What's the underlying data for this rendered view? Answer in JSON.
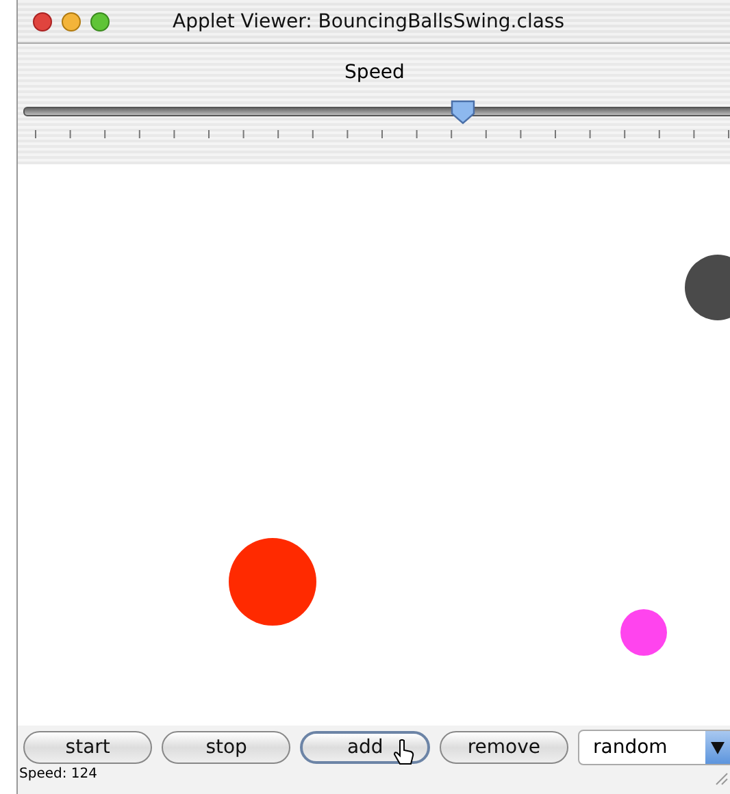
{
  "window": {
    "title": "Applet Viewer: BouncingBallsSwing.class"
  },
  "slider": {
    "label": "Speed",
    "level": 0.62
  },
  "balls": [
    {
      "color": "#4a4a4a"
    },
    {
      "color": "#ff2a00"
    },
    {
      "color": "#ff44ee"
    }
  ],
  "buttons": [
    {
      "label": "start",
      "focused": false
    },
    {
      "label": "stop",
      "focused": false
    },
    {
      "label": "add",
      "focused": true
    },
    {
      "label": "remove",
      "focused": false
    }
  ],
  "dropdown": {
    "value": "random"
  },
  "status_bar": {
    "text": "Speed: 124"
  }
}
